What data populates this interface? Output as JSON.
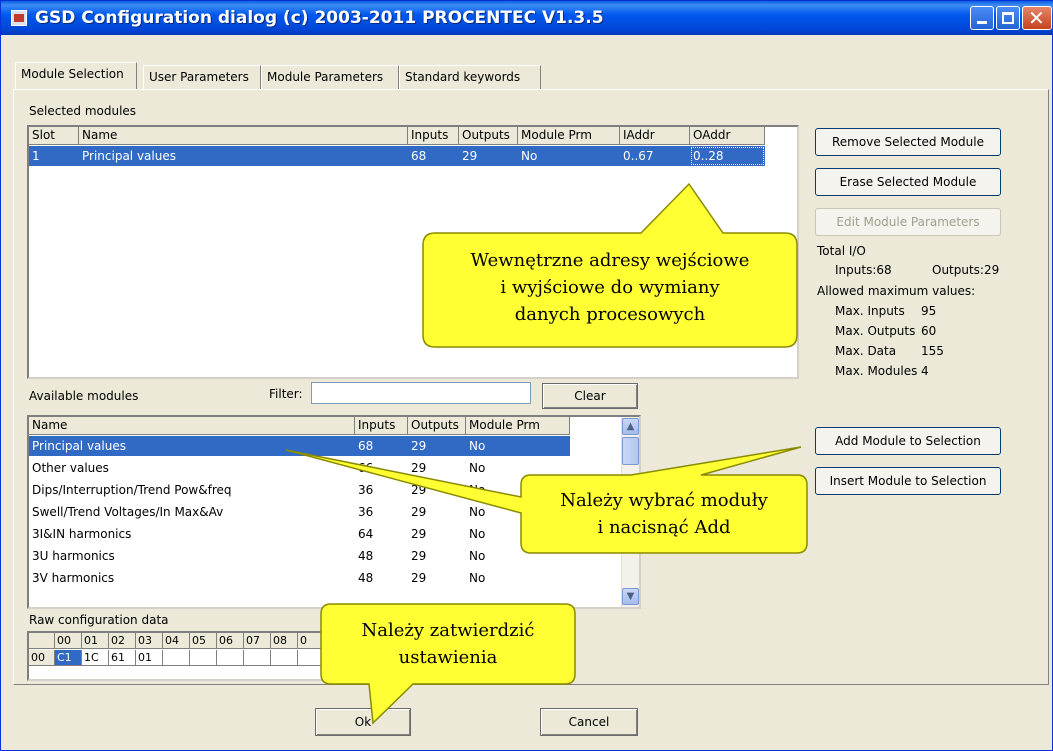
{
  "window": {
    "title": "GSD Configuration dialog (c) 2003-2011 PROCENTEC V1.3.5"
  },
  "tabs": [
    {
      "label": "Module Selection",
      "active": true
    },
    {
      "label": "User Parameters",
      "active": false
    },
    {
      "label": "Module Parameters",
      "active": false
    },
    {
      "label": "Standard keywords",
      "active": false
    }
  ],
  "selected_modules": {
    "label": "Selected modules",
    "columns": [
      "Slot",
      "Name",
      "Inputs",
      "Outputs",
      "Module Prm",
      "IAddr",
      "OAddr"
    ],
    "rows": [
      {
        "slot": "1",
        "name": "Principal values",
        "inputs": "68",
        "outputs": "29",
        "module_prm": "No",
        "iaddr": "0..67",
        "oaddr": "0..28",
        "selected": true
      }
    ]
  },
  "right_panel": {
    "remove_button": "Remove Selected Module",
    "erase_button": "Erase Selected Module",
    "edit_button": "Edit Module Parameters",
    "total_io_label": "Total I/O",
    "inputs_text": "Inputs:68",
    "outputs_text": "Outputs:29",
    "allowed_label": "Allowed maximum values:",
    "max": [
      {
        "label": "Max. Inputs",
        "value": "95"
      },
      {
        "label": "Max. Outputs",
        "value": "60"
      },
      {
        "label": "Max. Data",
        "value": "155"
      },
      {
        "label": "Max. Modules",
        "value": "4"
      }
    ],
    "add_button": "Add Module to Selection",
    "insert_button": "Insert Module to Selection"
  },
  "available_modules": {
    "label": "Available modules",
    "filter_label": "Filter:",
    "filter_value": "",
    "clear_button": "Clear",
    "columns": [
      "Name",
      "Inputs",
      "Outputs",
      "Module Prm"
    ],
    "rows": [
      {
        "name": "Principal values",
        "inputs": "68",
        "outputs": "29",
        "module_prm": "No",
        "selected": true
      },
      {
        "name": "Other values",
        "inputs": "66",
        "outputs": "29",
        "module_prm": "No",
        "selected": false
      },
      {
        "name": "Dips/Interruption/Trend Pow&freq",
        "inputs": "36",
        "outputs": "29",
        "module_prm": "No",
        "selected": false
      },
      {
        "name": "Swell/Trend Voltages/In Max&Av",
        "inputs": "36",
        "outputs": "29",
        "module_prm": "No",
        "selected": false
      },
      {
        "name": "3I&IN harmonics",
        "inputs": "64",
        "outputs": "29",
        "module_prm": "No",
        "selected": false
      },
      {
        "name": "3U harmonics",
        "inputs": "48",
        "outputs": "29",
        "module_prm": "No",
        "selected": false
      },
      {
        "name": "3V harmonics",
        "inputs": "48",
        "outputs": "29",
        "module_prm": "No",
        "selected": false
      }
    ]
  },
  "raw_config": {
    "label": "Raw configuration data",
    "header": [
      "00",
      "01",
      "02",
      "03",
      "04",
      "05",
      "06",
      "07",
      "08",
      "0"
    ],
    "row_label": "00",
    "values": [
      "C1",
      "1C",
      "61",
      "01"
    ]
  },
  "footer": {
    "ok_button": "Ok",
    "cancel_button": "Cancel"
  },
  "callouts": {
    "addresses": [
      "Wewnętrzne adresy wejściowe",
      "i wyjściowe do wymiany",
      "danych procesowych"
    ],
    "add": [
      "Należy wybrać moduły",
      "i nacisnąć Add"
    ],
    "confirm": [
      "Należy zatwierdzić",
      "ustawienia"
    ]
  },
  "colors": {
    "selection": "#316ac5",
    "callout_fill": "#ffff33",
    "titlebar": "#0058ee"
  }
}
